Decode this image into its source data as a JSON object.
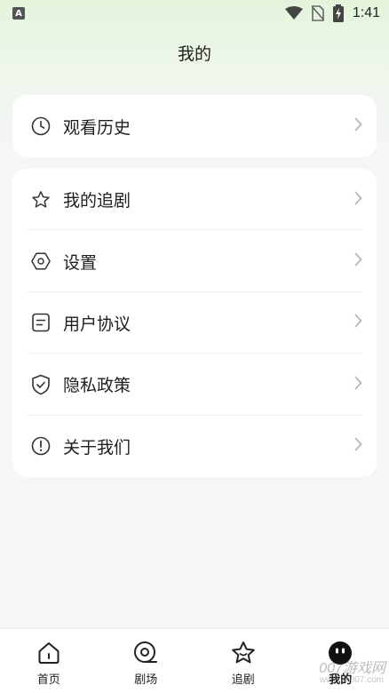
{
  "status_bar": {
    "time": "1:41"
  },
  "header": {
    "title": "我的"
  },
  "menu_card_top": {
    "items": [
      {
        "label": "观看历史",
        "icon": "clock-icon"
      }
    ]
  },
  "menu_card_main": {
    "items": [
      {
        "label": "我的追剧",
        "icon": "star-icon"
      },
      {
        "label": "设置",
        "icon": "hexagon-settings-icon"
      },
      {
        "label": "用户协议",
        "icon": "document-icon"
      },
      {
        "label": "隐私政策",
        "icon": "shield-check-icon"
      },
      {
        "label": "关于我们",
        "icon": "info-circle-icon"
      }
    ]
  },
  "tabbar": {
    "tabs": [
      {
        "label": "首页",
        "icon": "home-icon",
        "active": false
      },
      {
        "label": "剧场",
        "icon": "theater-icon",
        "active": false
      },
      {
        "label": "追剧",
        "icon": "star-icon",
        "active": false
      },
      {
        "label": "我的",
        "icon": "profile-face-icon",
        "active": true
      }
    ]
  },
  "watermark": {
    "text": "007游戏网",
    "url_text": "www.yx007.com"
  },
  "colors": {
    "background": "#f5f6f8",
    "header_gradient": "#e3f4db",
    "card": "#ffffff",
    "icon_stroke": "#333333",
    "chevron": "#b8b8b8"
  }
}
